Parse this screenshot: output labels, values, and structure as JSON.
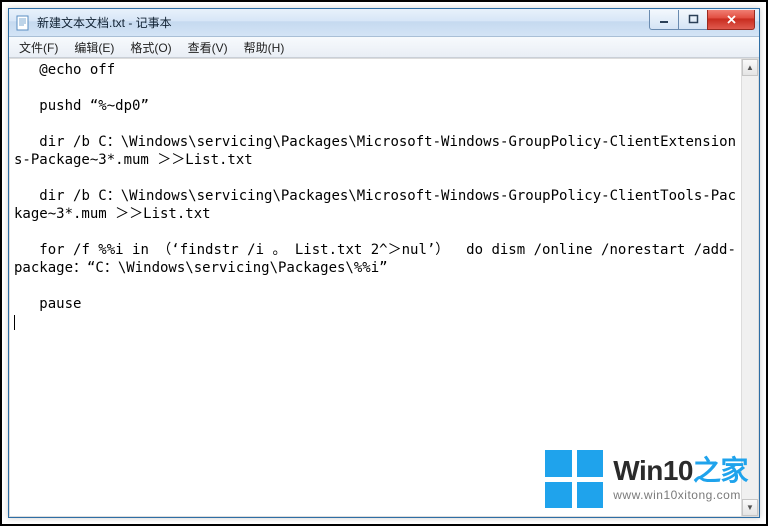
{
  "window": {
    "title": "新建文本文档.txt - 记事本"
  },
  "menu": {
    "file": "文件(F)",
    "edit": "编辑(E)",
    "format": "格式(O)",
    "view": "查看(V)",
    "help": "帮助(H)"
  },
  "content": {
    "text": "   @echo off\n\n   pushd “%~dp0”\n\n   dir /b C：\\Windows\\servicing\\Packages\\Microsoft-Windows-GroupPolicy-ClientExtensions-Package~3*.mum ＞＞List.txt\n\n   dir /b C：\\Windows\\servicing\\Packages\\Microsoft-Windows-GroupPolicy-ClientTools-Package~3*.mum ＞＞List.txt\n\n   for /f %%i in （‘findstr /i 。 List.txt 2^＞nul’）  do dism /online /norestart /add-package：“C：\\Windows\\servicing\\Packages\\%%i”\n\n   pause\n"
  },
  "watermark": {
    "brand_prefix": "Win10",
    "brand_suffix": "之家",
    "url": "www.win10xitong.com"
  }
}
